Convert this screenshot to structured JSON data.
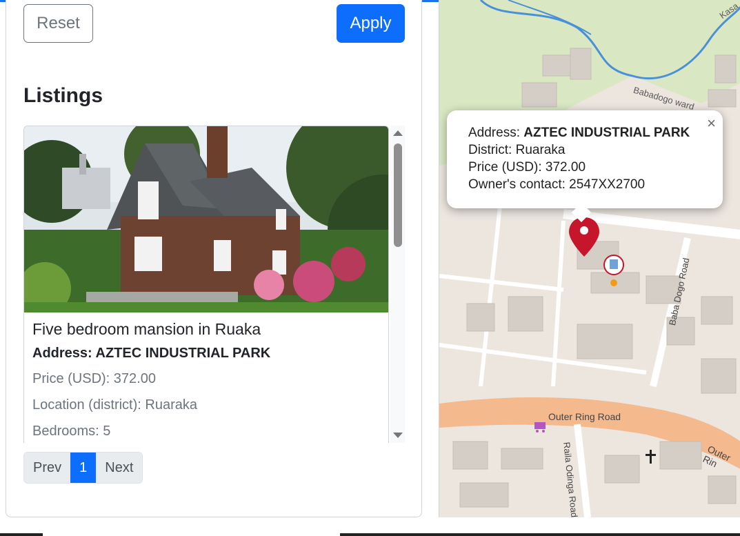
{
  "filters": {
    "reset_label": "Reset",
    "apply_label": "Apply"
  },
  "listings": {
    "heading": "Listings",
    "card": {
      "title": "Five bedroom mansion in Ruaka",
      "address": "Address: AZTEC INDUSTRIAL PARK",
      "price": "Price (USD): 372.00",
      "location": "Location (district): Ruaraka",
      "bedrooms": "Bedrooms: 5"
    }
  },
  "pagination": {
    "prev_label": "Prev",
    "current_page": "1",
    "next_label": "Next"
  },
  "map": {
    "labels": {
      "outer_ring": "Outer Ring Road",
      "outer_ring_2": "Outer Rin",
      "baba_dogo": "Baba Dogo Road",
      "raila": "Raila Odinga Road",
      "babadogo": "Babadogo ward",
      "kasa": "Kasa"
    },
    "popup": {
      "address_label": "Address: ",
      "address_value": "AZTEC INDUSTRIAL PARK",
      "district": "District: Ruaraka",
      "price": "Price (USD): 372.00",
      "contact": "Owner's contact: 2547XX2700",
      "close_symbol": "×"
    }
  },
  "colors": {
    "primary": "#0d6efd",
    "secondary": "#6c757d",
    "marker_red": "#c5162c",
    "road_orange": "#f4b98d",
    "water_blue": "#4a90d9",
    "park_green": "#d9e8c3"
  }
}
